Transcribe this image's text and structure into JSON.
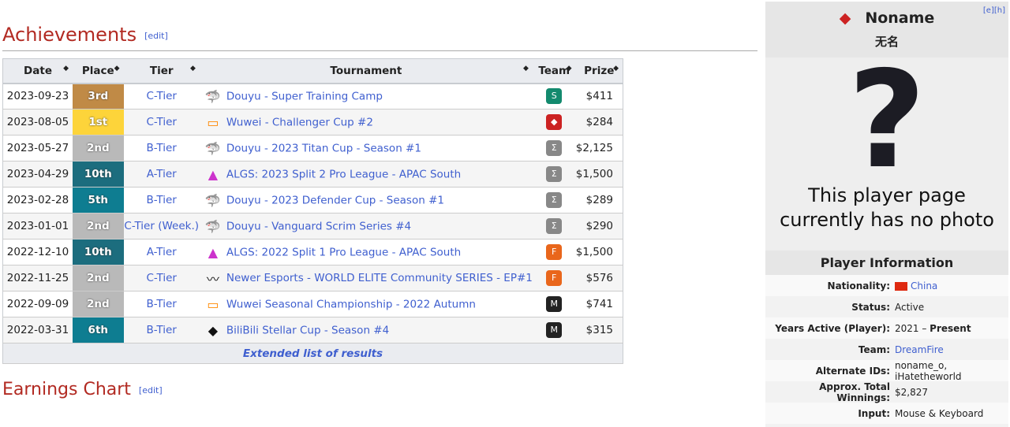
{
  "achievements": {
    "title": "Achievements",
    "edit": "[edit]",
    "columns": [
      "Date",
      "Place",
      "Tier",
      "Tournament",
      "Team",
      "Prize"
    ],
    "rows": [
      {
        "date": "2023-09-23",
        "place": "3rd",
        "place_color": "#c08a46",
        "tier": "C-Tier",
        "tier_extra": "",
        "tournament": "Douyu - Super Training Camp",
        "icon": "douyu-icon",
        "team_icon": "green-team-icon",
        "prize": "$411"
      },
      {
        "date": "2023-08-05",
        "place": "1st",
        "place_color": "#fdd43a",
        "tier": "C-Tier",
        "tier_extra": "",
        "tournament": "Wuwei - Challenger Cup #2",
        "icon": "wuwei-icon",
        "team_icon": "dreamfire-icon",
        "prize": "$284"
      },
      {
        "date": "2023-05-27",
        "place": "2nd",
        "place_color": "#b9b9b9",
        "tier": "B-Tier",
        "tier_extra": "",
        "tournament": "Douyu - 2023 Titan Cup - Season #1",
        "icon": "douyu-icon",
        "team_icon": "sigma-team-icon",
        "prize": "$2,125"
      },
      {
        "date": "2023-04-29",
        "place": "10th",
        "place_color": "#1c6d7e",
        "tier": "A-Tier",
        "tier_extra": "",
        "tournament": "ALGS: 2023 Split 2 Pro League - APAC South",
        "icon": "apex-icon",
        "team_icon": "sigma-team-icon",
        "prize": "$1,500"
      },
      {
        "date": "2023-02-28",
        "place": "5th",
        "place_color": "#0e7d91",
        "tier": "B-Tier",
        "tier_extra": "",
        "tournament": "Douyu - 2023 Defender Cup - Season #1",
        "icon": "douyu-icon",
        "team_icon": "sigma-team-icon",
        "prize": "$289"
      },
      {
        "date": "2023-01-01",
        "place": "2nd",
        "place_color": "#b9b9b9",
        "tier": "C-Tier",
        "tier_extra": "(Week.)",
        "tournament": "Douyu - Vanguard Scrim Series #4",
        "icon": "douyu-icon",
        "team_icon": "sigma-team-icon",
        "prize": "$290"
      },
      {
        "date": "2022-12-10",
        "place": "10th",
        "place_color": "#1c6d7e",
        "tier": "A-Tier",
        "tier_extra": "",
        "tournament": "ALGS: 2022 Split 1 Pro League - APAC South",
        "icon": "apex-icon",
        "team_icon": "orange-team-icon",
        "prize": "$1,500"
      },
      {
        "date": "2022-11-25",
        "place": "2nd",
        "place_color": "#b9b9b9",
        "tier": "C-Tier",
        "tier_extra": "",
        "tournament": "Newer Esports - WORLD ELITE Community SERIES - EP#1",
        "icon": "newer-icon",
        "team_icon": "orange-team-icon",
        "prize": "$576"
      },
      {
        "date": "2022-09-09",
        "place": "2nd",
        "place_color": "#b9b9b9",
        "tier": "B-Tier",
        "tier_extra": "",
        "tournament": "Wuwei Seasonal Championship - 2022 Autumn",
        "icon": "wuwei-icon",
        "team_icon": "myd-team-icon",
        "prize": "$741"
      },
      {
        "date": "2022-03-31",
        "place": "6th",
        "place_color": "#0e7d91",
        "tier": "B-Tier",
        "tier_extra": "",
        "tournament": "BiliBili Stellar Cup - Season #4",
        "icon": "bilibili-icon",
        "team_icon": "myd-team-icon",
        "prize": "$315"
      }
    ],
    "extended": "Extended list of results"
  },
  "earnings": {
    "title": "Earnings Chart",
    "edit": "[edit]"
  },
  "infobox": {
    "name": "Noname",
    "native": "无名",
    "edit_links": "[e][h]",
    "no_photo": "This player page currently has no photo",
    "section": "Player Information",
    "fields": [
      {
        "k": "Nationality:",
        "v": "China"
      },
      {
        "k": "Status:",
        "v": "Active"
      },
      {
        "k": "Years Active (Player):",
        "v": "2021 – ",
        "v2": "Present"
      },
      {
        "k": "Team:",
        "v": "DreamFire"
      },
      {
        "k": "Alternate IDs:",
        "v": "noname_o, iHatetheworld"
      },
      {
        "k": "Approx. Total Winnings:",
        "v": "$2,827"
      },
      {
        "k": "Input:",
        "v": "Mouse & Keyboard"
      }
    ]
  }
}
